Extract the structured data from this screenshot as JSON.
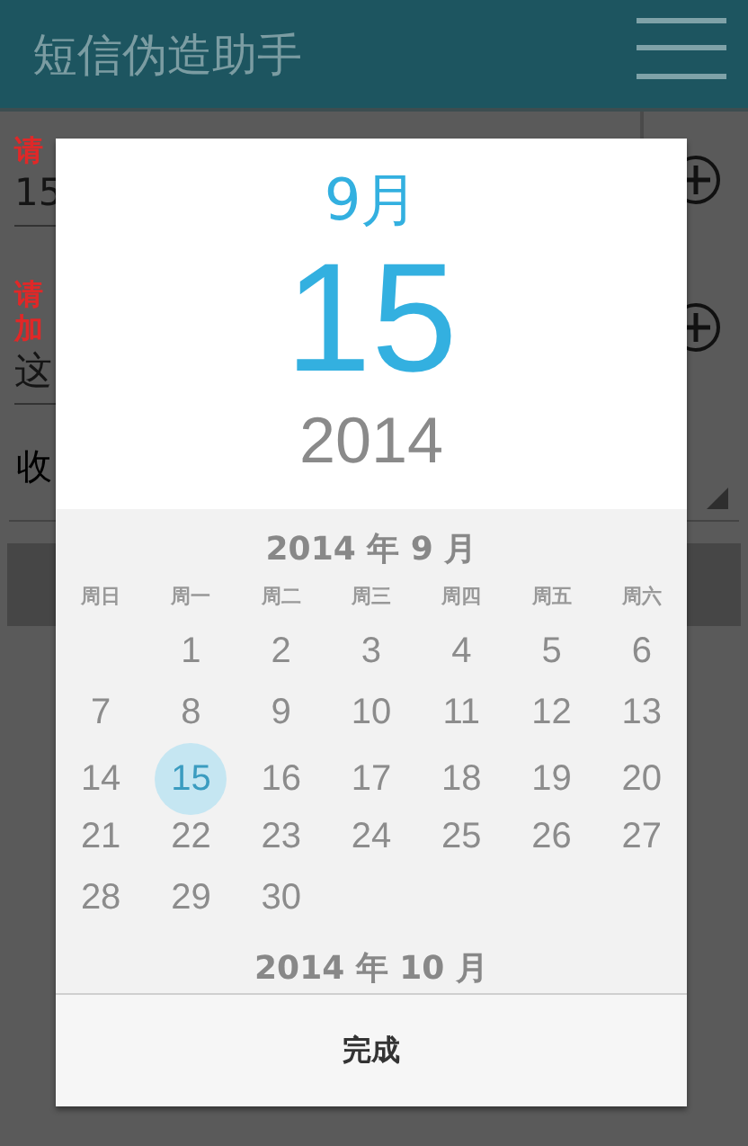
{
  "app_bar": {
    "title": "短信伪造助手"
  },
  "form": [
    {
      "kind": "label",
      "text": "请"
    },
    {
      "kind": "value",
      "text": "15"
    },
    {
      "kind": "label",
      "text": "请"
    },
    {
      "kind": "label",
      "text": "加"
    },
    {
      "kind": "value",
      "text": "这"
    }
  ],
  "spinner": {
    "text": "收"
  },
  "dialog": {
    "month": "9月",
    "day": "15",
    "year": "2014",
    "calendar": {
      "month_title": "2014 年 9 月",
      "weekdays": [
        "周日",
        "周一",
        "周二",
        "周三",
        "周四",
        "周五",
        "周六"
      ],
      "weeks": [
        [
          {
            "label": "1",
            "selected": false
          },
          {
            "label": "2",
            "selected": false
          },
          {
            "label": "3",
            "selected": false
          },
          {
            "label": "4",
            "selected": false
          },
          {
            "label": "5",
            "selected": false
          },
          {
            "label": "6",
            "selected": false
          }
        ],
        [
          {
            "label": "7",
            "selected": false
          },
          {
            "label": "8",
            "selected": false
          },
          {
            "label": "9",
            "selected": false
          },
          {
            "label": "10",
            "selected": false
          },
          {
            "label": "11",
            "selected": false
          },
          {
            "label": "12",
            "selected": false
          },
          {
            "label": "13",
            "selected": false
          }
        ],
        [
          {
            "label": "14",
            "selected": false
          },
          {
            "label": "15",
            "selected": true
          },
          {
            "label": "16",
            "selected": false
          },
          {
            "label": "17",
            "selected": false
          },
          {
            "label": "18",
            "selected": false
          },
          {
            "label": "19",
            "selected": false
          },
          {
            "label": "20",
            "selected": false
          }
        ],
        [
          {
            "label": "21",
            "selected": false
          },
          {
            "label": "22",
            "selected": false
          },
          {
            "label": "23",
            "selected": false
          },
          {
            "label": "24",
            "selected": false
          },
          {
            "label": "25",
            "selected": false
          },
          {
            "label": "26",
            "selected": false
          },
          {
            "label": "27",
            "selected": false
          }
        ],
        [
          {
            "label": "28",
            "selected": false
          },
          {
            "label": "29",
            "selected": false
          },
          {
            "label": "30",
            "selected": false
          }
        ]
      ],
      "next_month_title": "2014 年 10 月"
    },
    "done_button": "完成"
  }
}
